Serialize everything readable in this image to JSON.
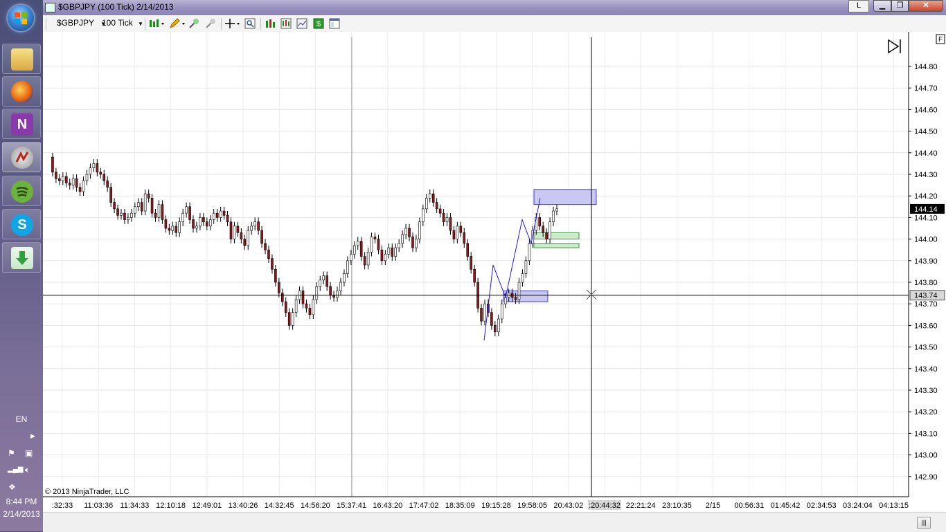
{
  "taskbar": {
    "apps": [
      {
        "name": "Windows Explorer",
        "icon": "folder-icon"
      },
      {
        "name": "Firefox",
        "icon": "firefox-icon"
      },
      {
        "name": "OneNote",
        "icon": "onenote-icon"
      },
      {
        "name": "NinjaTrader",
        "icon": "ninjatrader-icon",
        "active": true
      },
      {
        "name": "Spotify",
        "icon": "spotify-icon"
      },
      {
        "name": "Skype",
        "icon": "skype-icon"
      },
      {
        "name": "Downloader",
        "icon": "download-icon"
      }
    ],
    "language": "EN",
    "time": "8:44 PM",
    "date": "2/14/2013"
  },
  "window": {
    "title": "$GBPJPY (100 Tick)  2/14/2013",
    "link_button": "L"
  },
  "toolbar": {
    "instrument": "$GBPJPY",
    "interval": "100 Tick"
  },
  "chart": {
    "copyright": "© 2013 NinjaTrader, LLC",
    "f_marker": "F",
    "price_labels": [
      "144.80",
      "144.70",
      "144.60",
      "144.50",
      "144.40",
      "144.30",
      "144.20",
      "144.10",
      "144.00",
      "143.90",
      "143.80",
      "143.70",
      "143.60",
      "143.50",
      "143.40",
      "143.30",
      "143.20",
      "143.10",
      "143.00",
      "142.90"
    ],
    "time_labels": [
      ":32:33",
      "11:03:36",
      "11:34:33",
      "12:10:18",
      "12:49:01",
      "13:40:26",
      "14:32:45",
      "14:56:20",
      "15:37:41",
      "16:43:20",
      "17:47:02",
      "18:35:09",
      "19:15:28",
      "19:58:05",
      "20:43:02",
      ":20:44:32",
      "22:21:24",
      "23:10:35",
      "2/15",
      "00:56:31",
      "01:45:42",
      "02:34:53",
      "03:24:04",
      "04:13:15"
    ],
    "last_price": "144.14",
    "crosshair_price": "143.74",
    "crosshair_time": ":20:44:32",
    "colors": {
      "up": "#ffffff",
      "down": "#8b1a1a",
      "zone_blue": "#c8c8f2",
      "zone_green": "#cfe9cf",
      "line": "#1a1aff"
    }
  }
}
